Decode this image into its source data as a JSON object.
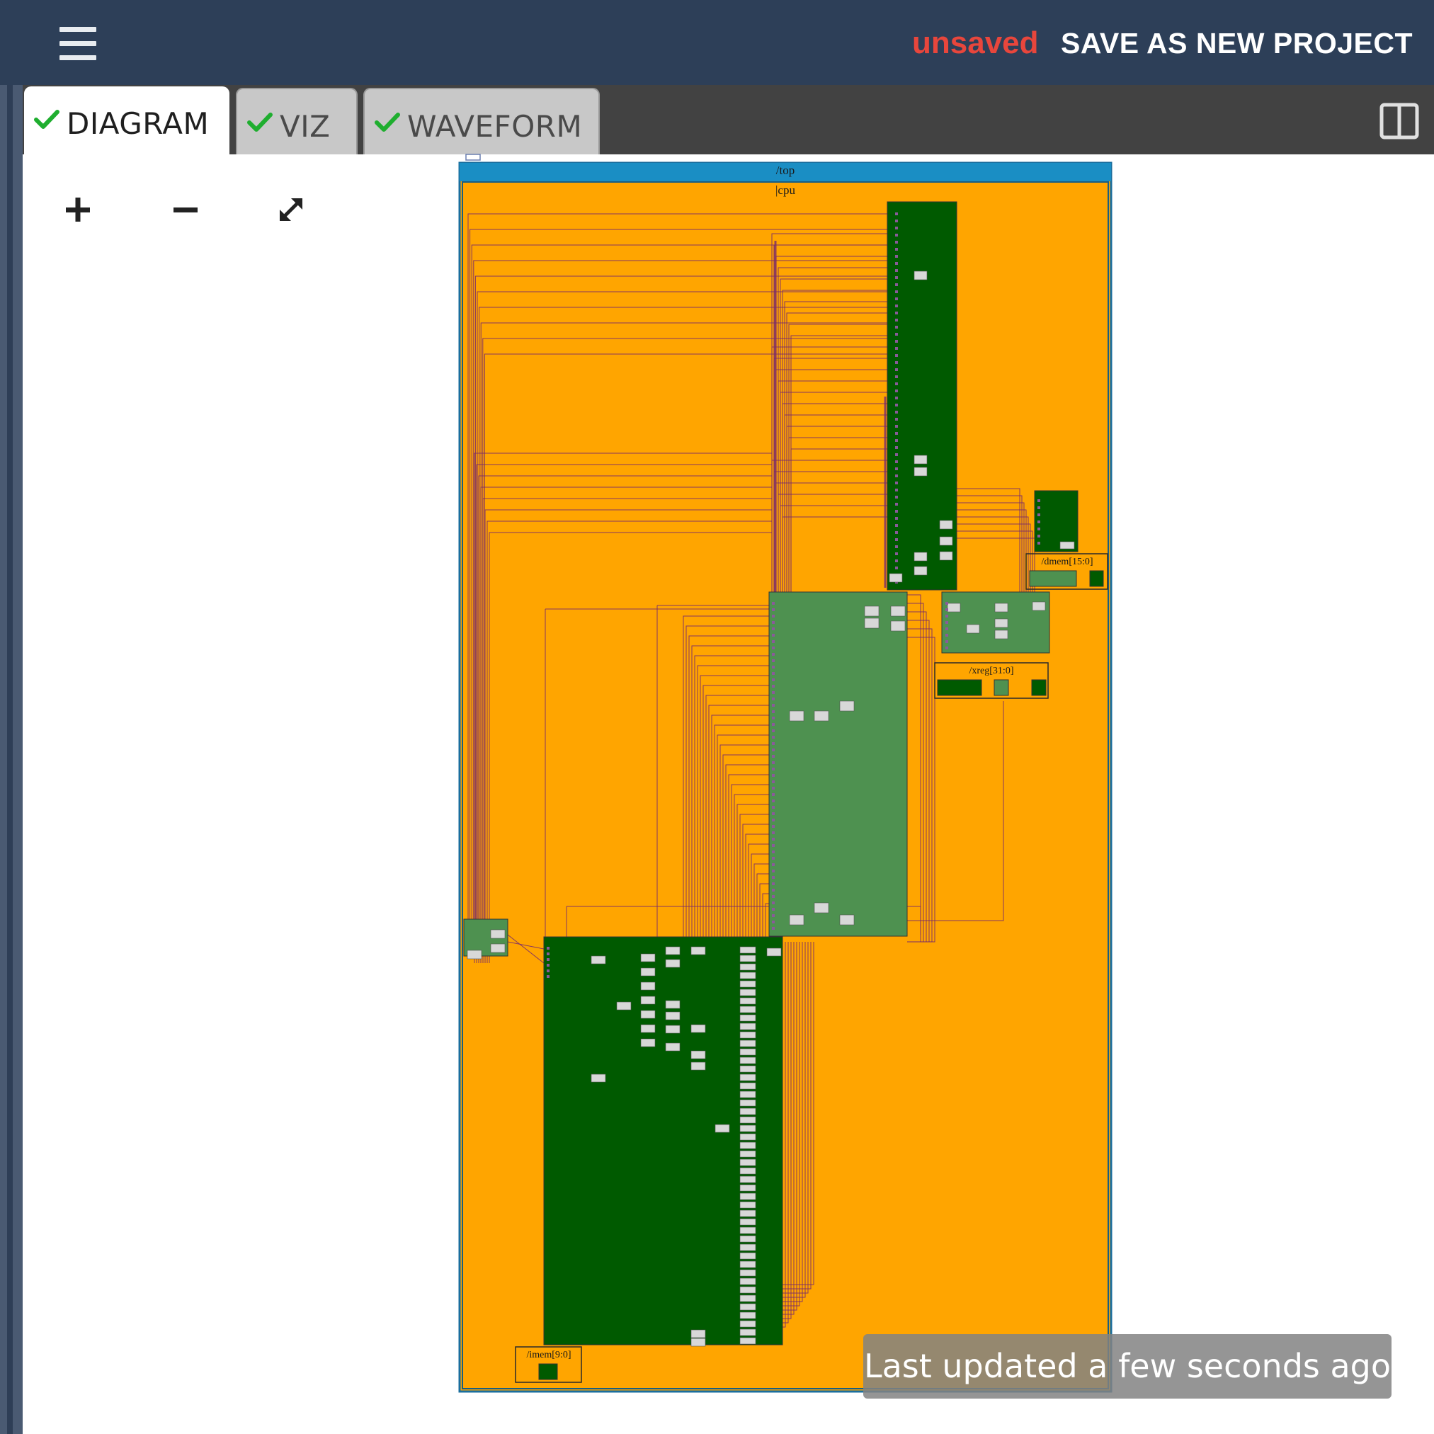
{
  "header": {
    "menu_icon": "hamburger-menu-icon",
    "status_text": "unsaved",
    "status_color": "#e8463c",
    "save_button_label": "SAVE AS NEW PROJECT",
    "background": "#2d3f58"
  },
  "tabs": [
    {
      "label": "DIAGRAM",
      "status_icon": "check-icon",
      "active": true
    },
    {
      "label": "VIZ",
      "status_icon": "check-icon",
      "active": false
    },
    {
      "label": "WAVEFORM",
      "status_icon": "check-icon",
      "active": false
    }
  ],
  "toolbar": {
    "zoom_in_icon": "plus-icon",
    "zoom_out_icon": "minus-icon",
    "fit_icon": "expand-icon",
    "split_view_icon": "split-view-icon"
  },
  "diagram": {
    "labels": {
      "top": "/top",
      "cpu": "|cpu",
      "dmem": "/dmem[15:0]",
      "xreg": "/xreg[31:0]",
      "imem": "/imem[9:0]"
    },
    "colors": {
      "top_header": "#1a8ec4",
      "cpu_fill": "#ffa500",
      "stage_dark": "#005a00",
      "stage_light": "#4e9150",
      "wire": "#7a2a6a"
    }
  },
  "toast": {
    "text": "Last updated a few seconds ago"
  }
}
